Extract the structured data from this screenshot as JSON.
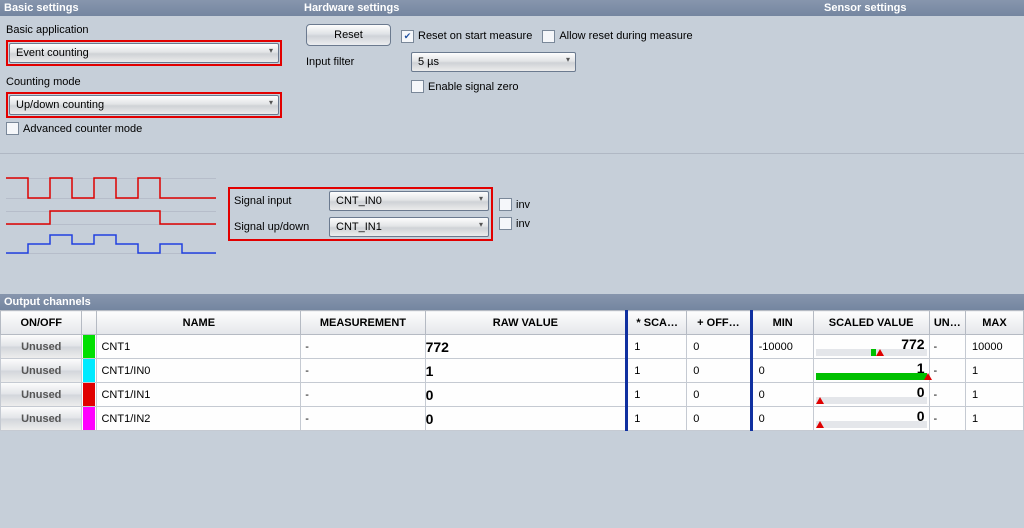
{
  "headers": {
    "basic": "Basic settings",
    "hardware": "Hardware settings",
    "sensor": "Sensor settings",
    "output": "Output channels"
  },
  "basic": {
    "app_label": "Basic application",
    "app_value": "Event counting",
    "mode_label": "Counting mode",
    "mode_value": "Up/down counting",
    "advanced_label": "Advanced counter mode",
    "advanced_checked": false
  },
  "hardware": {
    "reset_btn": "Reset",
    "reset_on_start_label": "Reset on start measure",
    "reset_on_start_checked": true,
    "allow_reset_label": "Allow reset during measure",
    "allow_reset_checked": false,
    "input_filter_label": "Input filter",
    "input_filter_value": "5 µs",
    "enable_zero_label": "Enable signal zero",
    "enable_zero_checked": false
  },
  "signals": {
    "input_label": "Signal input",
    "input_value": "CNT_IN0",
    "updown_label": "Signal up/down",
    "updown_value": "CNT_IN1",
    "inv_label": "inv",
    "input_inv_checked": false,
    "updown_inv_checked": false
  },
  "table": {
    "cols": {
      "onoff": "ON/OFF",
      "name": "NAME",
      "meas": "MEASUREMENT",
      "raw": "RAW VALUE",
      "scale": "* SCA…",
      "offset": "+ OFF…",
      "min": "MIN",
      "sval": "SCALED VALUE",
      "unit": "UN…",
      "max": "MAX"
    },
    "rows": [
      {
        "onoff": "Unused",
        "color": "#00e000",
        "name": "CNT1",
        "meas": "-",
        "raw": "772",
        "scale": "1",
        "offset": "0",
        "min": "-10000",
        "sval": "772",
        "unit": "-",
        "max": "10000",
        "barLeft": 50,
        "barWidth": 4,
        "marker": 54
      },
      {
        "onoff": "Unused",
        "color": "#00eaff",
        "name": "CNT1/IN0",
        "meas": "-",
        "raw": "1",
        "scale": "1",
        "offset": "0",
        "min": "0",
        "sval": "1",
        "unit": "-",
        "max": "1",
        "barLeft": 0,
        "barWidth": 100,
        "marker": 98
      },
      {
        "onoff": "Unused",
        "color": "#e00000",
        "name": "CNT1/IN1",
        "meas": "-",
        "raw": "0",
        "scale": "1",
        "offset": "0",
        "min": "0",
        "sval": "0",
        "unit": "-",
        "max": "1",
        "barLeft": 0,
        "barWidth": 0,
        "marker": 0
      },
      {
        "onoff": "Unused",
        "color": "#ff00ff",
        "name": "CNT1/IN2",
        "meas": "-",
        "raw": "0",
        "scale": "1",
        "offset": "0",
        "min": "0",
        "sval": "0",
        "unit": "-",
        "max": "1",
        "barLeft": 0,
        "barWidth": 0,
        "marker": 0
      }
    ]
  }
}
